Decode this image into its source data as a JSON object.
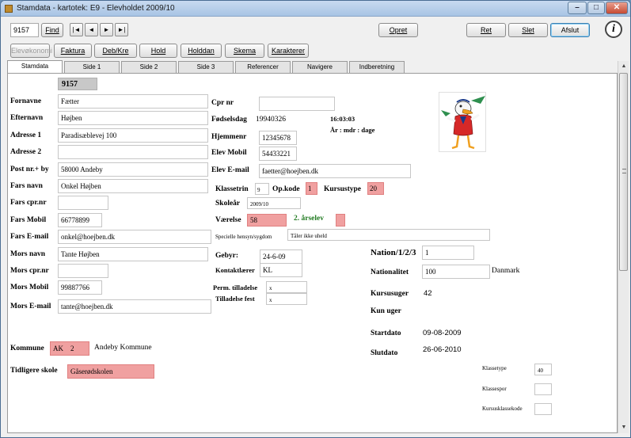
{
  "window": {
    "title": "Stamdata - kartotek: E9 - Elevholdet 2009/10",
    "controls": {
      "minimize": "–",
      "maximize": "□",
      "close": "✕"
    }
  },
  "toolbar": {
    "record_id": "9157",
    "find_label": "Find",
    "nav": {
      "first": "|◄",
      "prev": "◄",
      "next": "►",
      "last": "►|"
    },
    "create_label": "Opret",
    "reset_label": "Ret",
    "delete_label": "Slet",
    "close_label": "Afslut",
    "help_icon": "i",
    "row2": [
      "Elevøkonomi",
      "Faktura",
      "Deb/Kre",
      "Hold",
      "Holddan",
      "Skema",
      "Karakterer"
    ]
  },
  "tabs": [
    "Stamdata",
    "Side 1",
    "Side 2",
    "Side 3",
    "Referencer",
    "Navigere",
    "Indberetning"
  ],
  "form": {
    "id_badge": "9157",
    "left": {
      "fornavne": {
        "label": "Fornavne",
        "value": "Fætter"
      },
      "efternavn": {
        "label": "Efternavn",
        "value": "Højben"
      },
      "adresse1": {
        "label": "Adresse 1",
        "value": "Paradisæblevej 100"
      },
      "adresse2": {
        "label": "Adresse 2",
        "value": ""
      },
      "postnr": {
        "label": "Post nr.+ by",
        "value": "58000 Andeby"
      },
      "fars_navn": {
        "label": "Fars navn",
        "value": "Onkel Højben"
      },
      "fars_cpr": {
        "label": "Fars cpr.nr",
        "value": ""
      },
      "fars_mobil": {
        "label": "Fars Mobil",
        "value": "66778899"
      },
      "fars_email": {
        "label": "Fars E-mail",
        "value": "onkel@hoejben.dk"
      },
      "mors_navn": {
        "label": "Mors navn",
        "value": "Tante Højben"
      },
      "mors_cpr": {
        "label": "Mors cpr.nr",
        "value": ""
      },
      "mors_mobil": {
        "label": "Mors Mobil",
        "value": "99887766"
      },
      "mors_email": {
        "label": "Mors E-mail",
        "value": "tante@hoejben.dk"
      },
      "kommune": {
        "label": "Kommune",
        "code": "AK",
        "number": "2",
        "name": "Andeby Kommune"
      },
      "tidligere_skole": {
        "label": "Tidligere skole",
        "value": "Gåserødskolen"
      }
    },
    "middle": {
      "cpr": {
        "label": "Cpr nr",
        "value": ""
      },
      "foedselsdag": {
        "label": "Fødselsdag",
        "value": "19940326"
      },
      "time": "16:03:03",
      "age_caption": "År : mdr : dage",
      "hjemmenr": {
        "label": "Hjemmenr",
        "value": "12345678"
      },
      "elev_mobil": {
        "label": "Elev Mobil",
        "value": "54433221"
      },
      "elev_email": {
        "label": "Elev E-mail",
        "value": "faetter@hoejben.dk"
      },
      "klassetrin": {
        "label": "Klassetrin",
        "value": "9"
      },
      "opkode": {
        "label": "Op.kode",
        "value": "1"
      },
      "kursustype": {
        "label": "Kursustype",
        "value": "20"
      },
      "skoleaar": {
        "label": "Skoleår",
        "value": "2009/10"
      },
      "vaerelse": {
        "label": "Værelse",
        "value": "58"
      },
      "aarselev": "2. årselev",
      "hensyn": {
        "label": "Specielle hensyn/sygdom",
        "value": "Tåler ikke uheld"
      },
      "gebyr": {
        "label": "Gebyr:",
        "value": "24-6-09"
      },
      "kontaktlaerer": {
        "label": "Kontaktlærer",
        "value": "KL"
      },
      "perm_tilladelse": {
        "label": "Perm. tilladelse",
        "value": "x"
      },
      "tilladelse_fest": {
        "label": "Tilladelse fest",
        "value": "x"
      }
    },
    "right": {
      "nation": {
        "label": "Nation/1/2/3",
        "value": "1"
      },
      "nationalitet": {
        "label": "Nationalitet",
        "value": "100",
        "country": "Danmark"
      },
      "kursusuger": {
        "label": "Kursusuger",
        "value": "42"
      },
      "kun_uger": {
        "label": "Kun uger"
      },
      "startdato": {
        "label": "Startdato",
        "value": "09-08-2009"
      },
      "slutdato": {
        "label": "Slutdato",
        "value": "26-06-2010"
      },
      "klassetype": {
        "label": "Klassetype",
        "value": "40"
      },
      "klassespor": {
        "label": "Klassespor",
        "value": ""
      },
      "kursusklassekode": {
        "label": "Kursusklassekode",
        "value": ""
      }
    }
  },
  "colors": {
    "highlight": "#f0a0a0",
    "green_text": "#207a20",
    "badge": "#c8c8c8"
  }
}
